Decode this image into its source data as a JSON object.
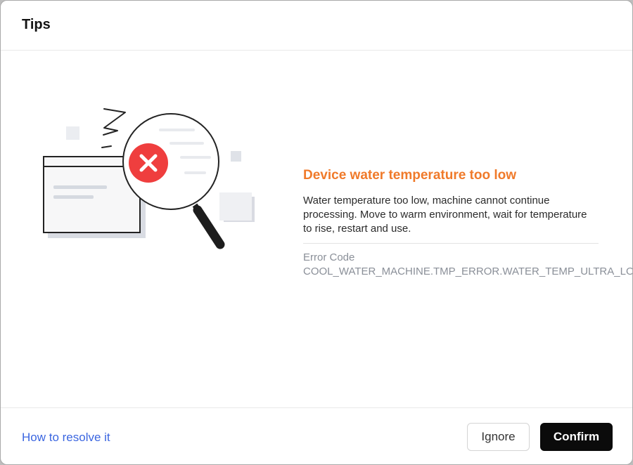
{
  "dialog": {
    "title": "Tips",
    "error": {
      "title": "Device water temperature too low",
      "description": "Water temperature too low, machine cannot continue processing. Move to warm environment, wait for temperature to rise, restart and use.",
      "code_label": "Error Code",
      "code_value": "COOL_WATER_MACHINE.TMP_ERROR.WATER_TEMP_ULTRA_LOW"
    },
    "footer": {
      "resolve_link": "How to resolve it",
      "ignore_label": "Ignore",
      "confirm_label": "Confirm"
    }
  },
  "colors": {
    "accent_error_title": "#f07a2a",
    "error_icon": "#ef3e3e",
    "link": "#3b66e0",
    "confirm_bg": "#0b0b0b"
  },
  "icons": {
    "illustration": "magnifier-error-illustration",
    "error_badge": "close-icon"
  }
}
